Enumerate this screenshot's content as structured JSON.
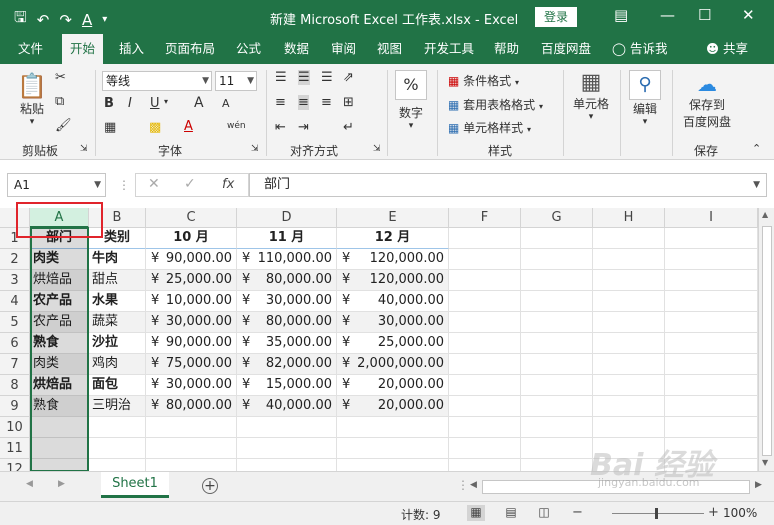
{
  "window": {
    "title": "新建 Microsoft Excel 工作表.xlsx  -  Excel",
    "login_label": "登录"
  },
  "tabs": [
    "文件",
    "开始",
    "插入",
    "页面布局",
    "公式",
    "数据",
    "审阅",
    "视图",
    "开发工具",
    "帮助",
    "百度网盘"
  ],
  "active_tab": "开始",
  "tell_me": "告诉我",
  "share": "共享",
  "ribbon": {
    "clipboard": {
      "paste": "粘贴",
      "label": "剪贴板"
    },
    "font": {
      "name": "等线",
      "size": "11",
      "label": "字体",
      "bold": "B",
      "italic": "I",
      "underline": "U",
      "grow": "A",
      "shrink": "A",
      "wen": "wén"
    },
    "alignment": {
      "label": "对齐方式"
    },
    "number": {
      "format_label": "数字",
      "pct": "%"
    },
    "styles": {
      "conditional": "条件格式",
      "table": "套用表格格式",
      "cell_styles": "单元格样式",
      "label": "样式"
    },
    "cells": {
      "label": "单元格"
    },
    "editing": {
      "label": "编辑"
    },
    "save_baidu": {
      "line1": "保存到",
      "line2": "百度网盘",
      "label": "保存"
    }
  },
  "formula_bar": {
    "name_box": "A1",
    "fx": "fx",
    "content": "部门"
  },
  "columns": [
    "A",
    "B",
    "C",
    "D",
    "E",
    "F",
    "G",
    "H",
    "I"
  ],
  "rows": [
    "1",
    "2",
    "3",
    "4",
    "5",
    "6",
    "7",
    "8",
    "9",
    "10",
    "11",
    "12"
  ],
  "table": {
    "headers": [
      "部门",
      "类别",
      "10 月",
      "11 月",
      "12 月"
    ],
    "currency": "¥",
    "data": [
      {
        "dept": "肉类",
        "cat": "牛肉",
        "oct": "90,000.00",
        "nov": "110,000.00",
        "dec": "120,000.00",
        "bold": true
      },
      {
        "dept": "烘焙品",
        "cat": "甜点",
        "oct": "25,000.00",
        "nov": "80,000.00",
        "dec": "120,000.00",
        "bold": false
      },
      {
        "dept": "农产品",
        "cat": "水果",
        "oct": "10,000.00",
        "nov": "30,000.00",
        "dec": "40,000.00",
        "bold": true
      },
      {
        "dept": "农产品",
        "cat": "蔬菜",
        "oct": "30,000.00",
        "nov": "80,000.00",
        "dec": "30,000.00",
        "bold": false
      },
      {
        "dept": "熟食",
        "cat": "沙拉",
        "oct": "90,000.00",
        "nov": "35,000.00",
        "dec": "25,000.00",
        "bold": true
      },
      {
        "dept": "肉类",
        "cat": "鸡肉",
        "oct": "75,000.00",
        "nov": "82,000.00",
        "dec": "2,000,000.00",
        "bold": false
      },
      {
        "dept": "烘焙品",
        "cat": "面包",
        "oct": "30,000.00",
        "nov": "15,000.00",
        "dec": "20,000.00",
        "bold": true
      },
      {
        "dept": "熟食",
        "cat": "三明治",
        "oct": "80,000.00",
        "nov": "40,000.00",
        "dec": "20,000.00",
        "bold": false
      }
    ]
  },
  "sheets": [
    "Sheet1"
  ],
  "status": {
    "count": "计数: 9",
    "zoom": "100%"
  },
  "watermark": {
    "logo": "Bai 经验",
    "url": "jingyan.baidu.com"
  }
}
